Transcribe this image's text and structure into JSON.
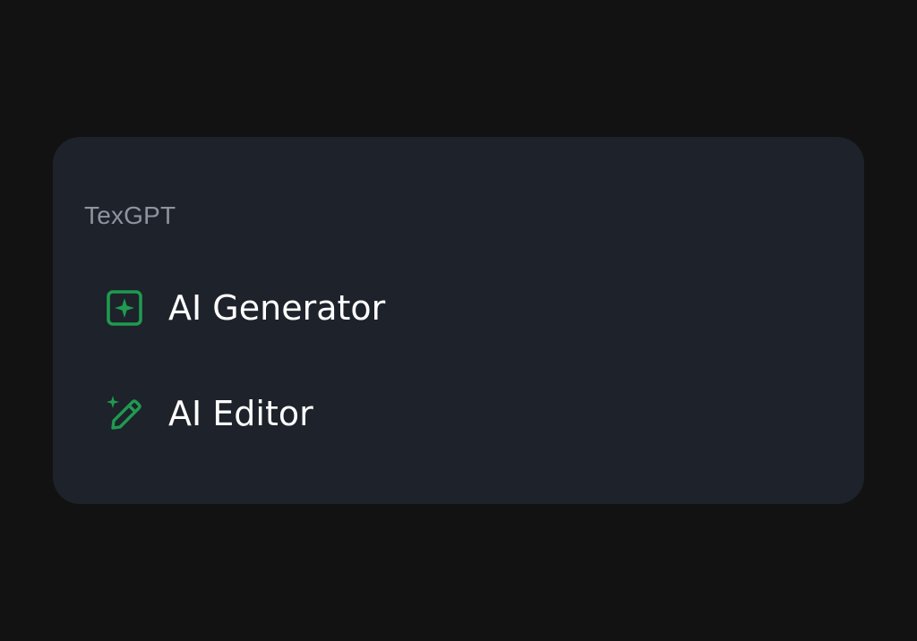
{
  "menu": {
    "section_title": "TexGPT",
    "accent_color": "#1f9a4f",
    "items": [
      {
        "label": "AI Generator",
        "icon": "sparkle-square-icon"
      },
      {
        "label": "AI Editor",
        "icon": "magic-pencil-icon"
      }
    ]
  }
}
